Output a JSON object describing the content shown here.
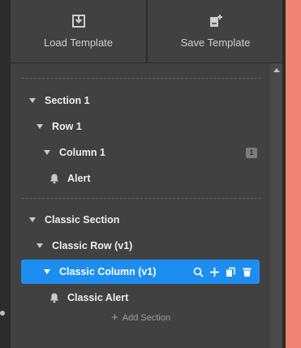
{
  "toolbar": {
    "load_label": "Load Template",
    "save_label": "Save Template"
  },
  "tree": {
    "section1": {
      "label": "Section 1"
    },
    "row1": {
      "label": "Row 1"
    },
    "column1": {
      "label": "Column 1",
      "badge": "1"
    },
    "alert": {
      "label": "Alert"
    },
    "classic_section": {
      "label": "Classic Section"
    },
    "classic_row": {
      "label": "Classic Row (v1)"
    },
    "classic_column": {
      "label": "Classic Column (v1)"
    },
    "classic_alert": {
      "label": "Classic Alert"
    }
  },
  "add_section": {
    "label": "Add Section"
  },
  "colors": {
    "selected_bg": "#1d8ef0",
    "accent_panel": "#f08472",
    "panel_bg": "#414141"
  },
  "icons": [
    "download-icon",
    "save-icon",
    "bell-icon",
    "search-icon",
    "plus-icon",
    "copy-icon",
    "trash-icon",
    "caret-down-icon"
  ]
}
